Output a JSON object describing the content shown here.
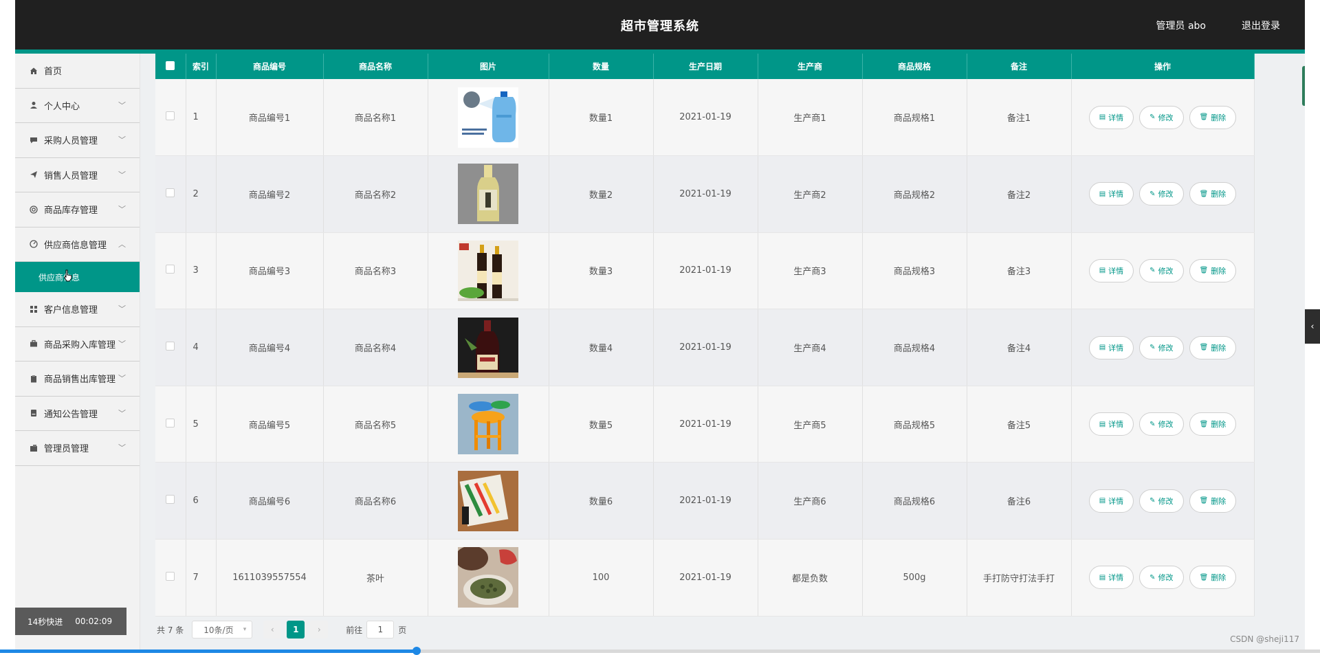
{
  "header": {
    "title": "超市管理系统",
    "admin_label": "管理员 abo",
    "logout_label": "退出登录"
  },
  "sidebar": {
    "items": [
      {
        "label": "首页",
        "icon": "home-icon",
        "chevron": ""
      },
      {
        "label": "个人中心",
        "icon": "user-icon",
        "chevron": "﹀"
      },
      {
        "label": "采购人员管理",
        "icon": "chat-icon",
        "chevron": "﹀"
      },
      {
        "label": "销售人员管理",
        "icon": "send-icon",
        "chevron": "﹀"
      },
      {
        "label": "商品库存管理",
        "icon": "target-icon",
        "chevron": "﹀"
      },
      {
        "label": "供应商信息管理",
        "icon": "gauge-icon",
        "chevron": "︿"
      },
      {
        "label": "客户信息管理",
        "icon": "grid-icon",
        "chevron": "﹀"
      },
      {
        "label": "商品采购入库管理",
        "icon": "briefcase-icon",
        "chevron": "﹀"
      },
      {
        "label": "商品销售出库管理",
        "icon": "clipboard-icon",
        "chevron": "﹀"
      },
      {
        "label": "通知公告管理",
        "icon": "document-icon",
        "chevron": "﹀"
      },
      {
        "label": "管理员管理",
        "icon": "wallet-icon",
        "chevron": "﹀"
      }
    ],
    "sub_item": "供应商信息"
  },
  "table": {
    "headers": [
      "索引",
      "商品编号",
      "商品名称",
      "图片",
      "数量",
      "生产日期",
      "生产商",
      "商品规格",
      "备注",
      "操作"
    ],
    "rows": [
      {
        "index": "1",
        "code": "商品编号1",
        "name": "商品名称1",
        "image": "water-jug",
        "qty": "数量1",
        "date": "2021-01-19",
        "maker": "生产商1",
        "spec": "商品规格1",
        "note": "备注1"
      },
      {
        "index": "2",
        "code": "商品编号2",
        "name": "商品名称2",
        "image": "liquor-bottle",
        "qty": "数量2",
        "date": "2021-01-19",
        "maker": "生产商2",
        "spec": "商品规格2",
        "note": "备注2"
      },
      {
        "index": "3",
        "code": "商品编号3",
        "name": "商品名称3",
        "image": "soy-sauce",
        "qty": "数量3",
        "date": "2021-01-19",
        "maker": "生产商3",
        "spec": "商品规格3",
        "note": "备注3"
      },
      {
        "index": "4",
        "code": "商品编号4",
        "name": "商品名称4",
        "image": "sauce-bottle",
        "qty": "数量4",
        "date": "2021-01-19",
        "maker": "生产商4",
        "spec": "商品规格4",
        "note": "备注4"
      },
      {
        "index": "5",
        "code": "商品编号5",
        "name": "商品名称5",
        "image": "stools",
        "qty": "数量5",
        "date": "2021-01-19",
        "maker": "生产商5",
        "spec": "商品规格5",
        "note": "备注5"
      },
      {
        "index": "6",
        "code": "商品编号6",
        "name": "商品名称6",
        "image": "brushes",
        "qty": "数量6",
        "date": "2021-01-19",
        "maker": "生产商6",
        "spec": "商品规格6",
        "note": "备注6"
      },
      {
        "index": "7",
        "code": "1611039557554",
        "name": "茶叶",
        "image": "tea",
        "qty": "100",
        "date": "2021-01-19",
        "maker": "都是负数",
        "spec": "500g",
        "note": "手打防守打法手打"
      }
    ],
    "actions": {
      "detail": "详情",
      "edit": "修改",
      "delete": "删除"
    }
  },
  "pagination": {
    "total": "共 7 条",
    "page_size": "10条/页",
    "prev": "‹",
    "current": "1",
    "next": "›",
    "goto_label": "前往",
    "goto_value": "1",
    "page_suffix": "页"
  },
  "overlay": {
    "speed_label": "14秒快进",
    "time": "00:02:09",
    "watermark": "CSDN @sheji117",
    "collapse_glyph": "‹"
  },
  "colors": {
    "header_bg": "#202020",
    "accent": "#009688",
    "progress": "#1e88e5"
  }
}
